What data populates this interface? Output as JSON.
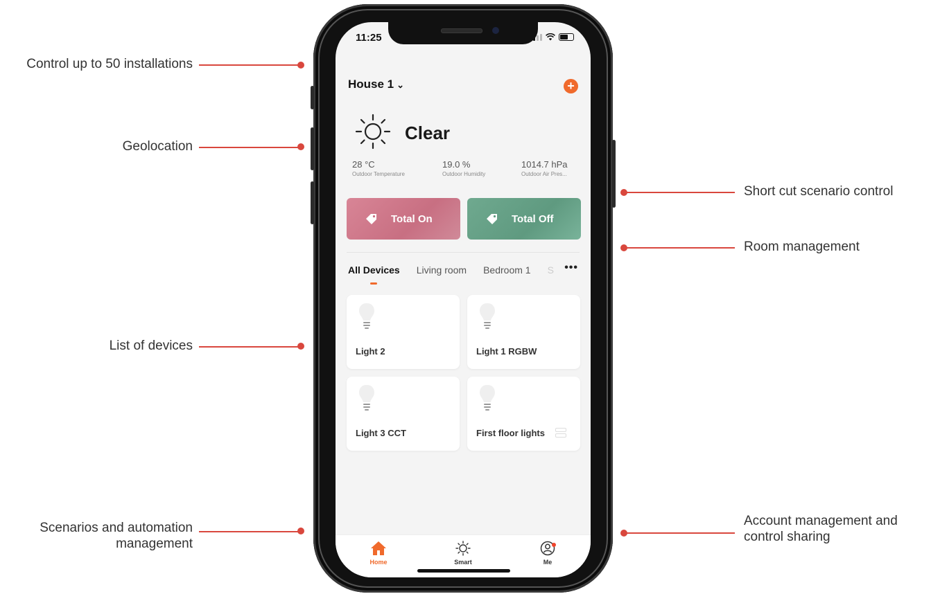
{
  "annotations": {
    "left": [
      {
        "text": "Control up to 50 installations"
      },
      {
        "text": "Geolocation"
      },
      {
        "text": "List of devices"
      },
      {
        "text": "Scenarios and automation management"
      }
    ],
    "right": [
      {
        "text": "Short cut scenario control"
      },
      {
        "text": "Room management"
      },
      {
        "text": "Account management and control sharing"
      }
    ]
  },
  "status_bar": {
    "time": "11:25"
  },
  "header": {
    "home_name": "House 1",
    "add_icon": "plus-circle-icon"
  },
  "weather": {
    "condition": "Clear",
    "icon": "sun-icon",
    "metrics": [
      {
        "value": "28 °C",
        "label": "Outdoor Temperature"
      },
      {
        "value": "19.0 %",
        "label": "Outdoor Humidity"
      },
      {
        "value": "1014.7 hPa",
        "label": "Outdoor Air Pres..."
      }
    ]
  },
  "scenes": [
    {
      "label": "Total On",
      "icon": "tag-icon"
    },
    {
      "label": "Total Off",
      "icon": "tag-icon"
    }
  ],
  "rooms": {
    "tabs": [
      "All Devices",
      "Living room",
      "Bedroom 1",
      "S"
    ],
    "active_index": 0,
    "more_label": "•••"
  },
  "devices": [
    {
      "name": "Light 2",
      "icon": "bulb-icon"
    },
    {
      "name": "Light 1 RGBW",
      "icon": "bulb-icon"
    },
    {
      "name": "Light 3 CCT",
      "icon": "bulb-icon"
    },
    {
      "name": "First floor lights",
      "icon": "bulb-icon",
      "group": true
    }
  ],
  "tabbar": [
    {
      "label": "Home",
      "icon": "home-icon",
      "active": true
    },
    {
      "label": "Smart",
      "icon": "sun-icon"
    },
    {
      "label": "Me",
      "icon": "profile-icon",
      "badge": true
    }
  ],
  "colors": {
    "accent": "#f06a2c",
    "annotation_line": "#d9473d",
    "total_on": "#c86f82",
    "total_off": "#5f9a80"
  }
}
